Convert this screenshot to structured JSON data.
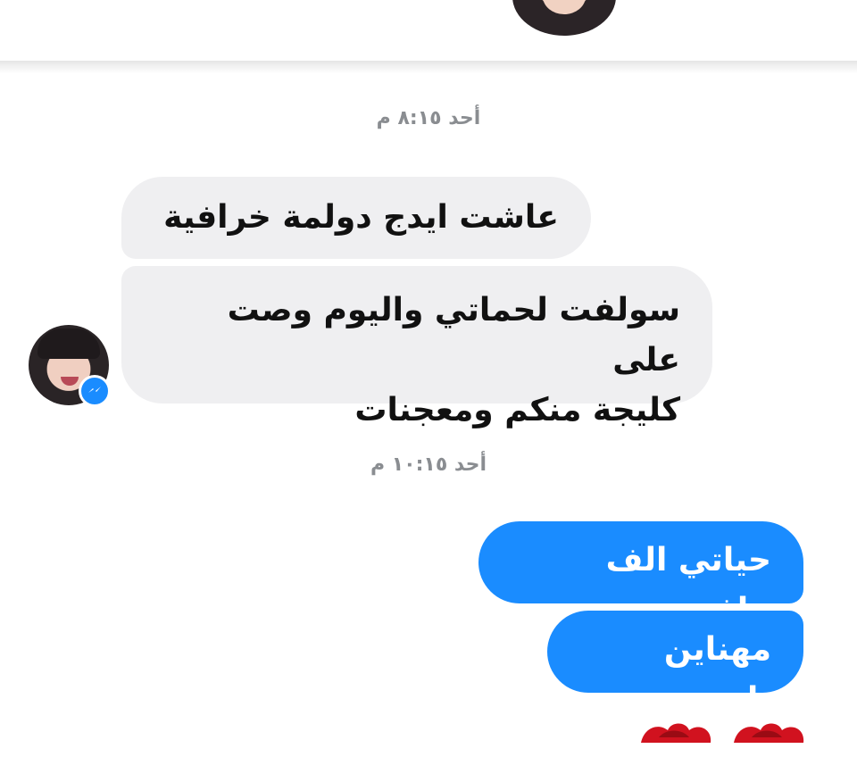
{
  "timestamps": [
    "أحد ٨:١٥ م",
    "أحد ١٠:١٥ م"
  ],
  "messages_incoming": [
    {
      "text": "عاشت ايدج دولمة خرافية"
    },
    {
      "line1": "سولفت لحماتي واليوم وصت على",
      "line2": "كليجة منكم ومعجنات"
    }
  ],
  "messages_outgoing": [
    {
      "text": "حياتي الف عافيه"
    },
    {
      "text": "مهناين يارب"
    }
  ],
  "icons": {
    "header_avatar": "profile-avatar",
    "sender_avatar": "profile-avatar",
    "badge": "messenger-icon",
    "reaction": "rose-emoji"
  },
  "colors": {
    "incoming_bubble": "#efeff1",
    "outgoing_bubble": "#1a8cff",
    "timestamp": "#8a8d91"
  }
}
